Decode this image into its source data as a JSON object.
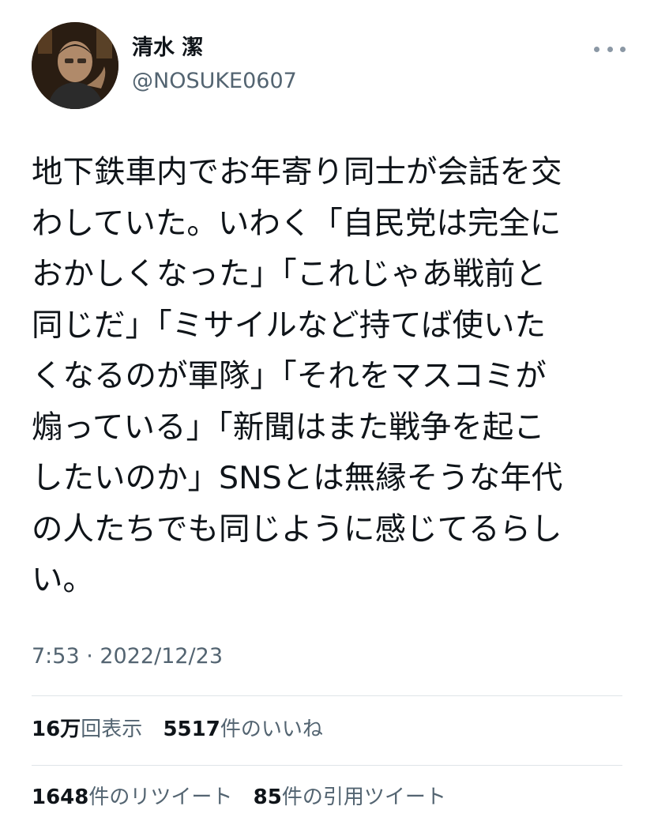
{
  "user": {
    "display_name": "清水 潔",
    "handle": "@NOSUKE0607"
  },
  "icons": {
    "avatar": "profile-photo",
    "more": "more-dots-icon"
  },
  "tweet": {
    "text": "地下鉄車内でお年寄り同士が会話を交\nわしていた。いわく「自民党は完全に\nおかしくなった」「これじゃあ戦前と\n同じだ」「ミサイルなど持てば使いた\nくなるのが軍隊」「それをマスコミが\n煽っている」「新聞はまた戦争を起こ\nしたいのか」SNSとは無縁そうな年代\nの人たちでも同じように感じてるらし\nい。",
    "timestamp": "7:53 · 2022/12/23"
  },
  "stats": {
    "views_count": "16万",
    "views_label": "回表示",
    "likes_count": "5517",
    "likes_label": "件のいいね",
    "retweets_count": "1648",
    "retweets_label": "件のリツイート",
    "quotes_count": "85",
    "quotes_label": "件の引用ツイート"
  },
  "colors": {
    "text_primary": "#0f1419",
    "text_secondary": "#536471",
    "divider": "#dfe4e8"
  }
}
